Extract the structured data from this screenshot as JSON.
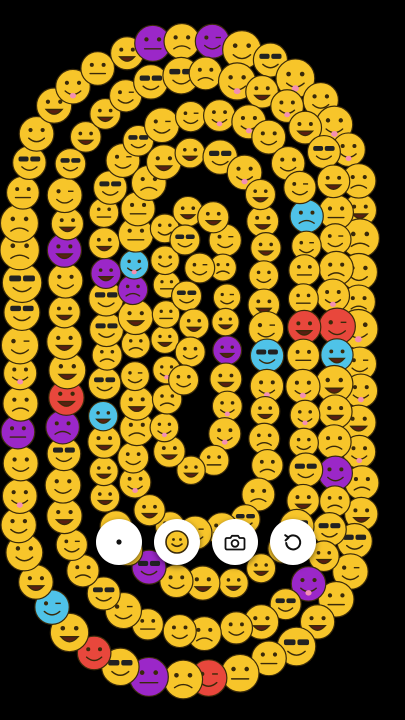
{
  "app": {
    "background_color": "#000000"
  },
  "canvas": {
    "content": "emoji-spiral-drawing",
    "stamp_glyph": "🙂",
    "face_color": "#f7c52a",
    "outline_color": "#3a2a0a",
    "accent_colors": {
      "purple": "#9b27c8",
      "red": "#e8473c",
      "blue": "#4fc3e8",
      "green": "#4cae4c",
      "pink": "#f48fb1"
    }
  },
  "toolbar": {
    "buttons": [
      {
        "name": "brush-size-button",
        "icon": "dot-icon"
      },
      {
        "name": "emoji-picker-button",
        "icon": "smiley-icon"
      },
      {
        "name": "screenshot-button",
        "icon": "camera-icon"
      },
      {
        "name": "undo-button",
        "icon": "undo-icon"
      }
    ],
    "button_color": "#ffffff",
    "icon_color": "#111111"
  }
}
